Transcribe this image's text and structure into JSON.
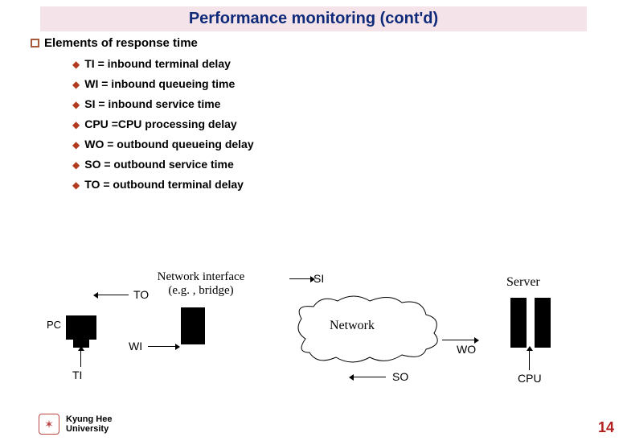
{
  "title": "Performance monitoring (cont'd)",
  "heading": "Elements of response time",
  "defs": [
    {
      "term": "TI",
      "desc": "= inbound terminal delay"
    },
    {
      "term": "WI",
      "desc": "= inbound queueing time"
    },
    {
      "term": "SI",
      "desc": "= inbound service time"
    },
    {
      "term": "CPU",
      "desc": "=CPU processing delay"
    },
    {
      "term": "WO",
      "desc": "= outbound queueing delay"
    },
    {
      "term": "SO",
      "desc": "= outbound service time"
    },
    {
      "term": "TO",
      "desc": "= outbound terminal delay"
    }
  ],
  "diagram": {
    "pc": "PC",
    "nic_line1": "Network interface",
    "nic_line2": "(e.g. , bridge)",
    "network": "Network",
    "server": "Server",
    "labels": {
      "TI": "TI",
      "TO": "TO",
      "WI": "WI",
      "SI": "SI",
      "WO": "WO",
      "SO": "SO",
      "CPU": "CPU"
    }
  },
  "footer": {
    "line1": "Kyung Hee",
    "line2": "University"
  },
  "page_number": "14"
}
